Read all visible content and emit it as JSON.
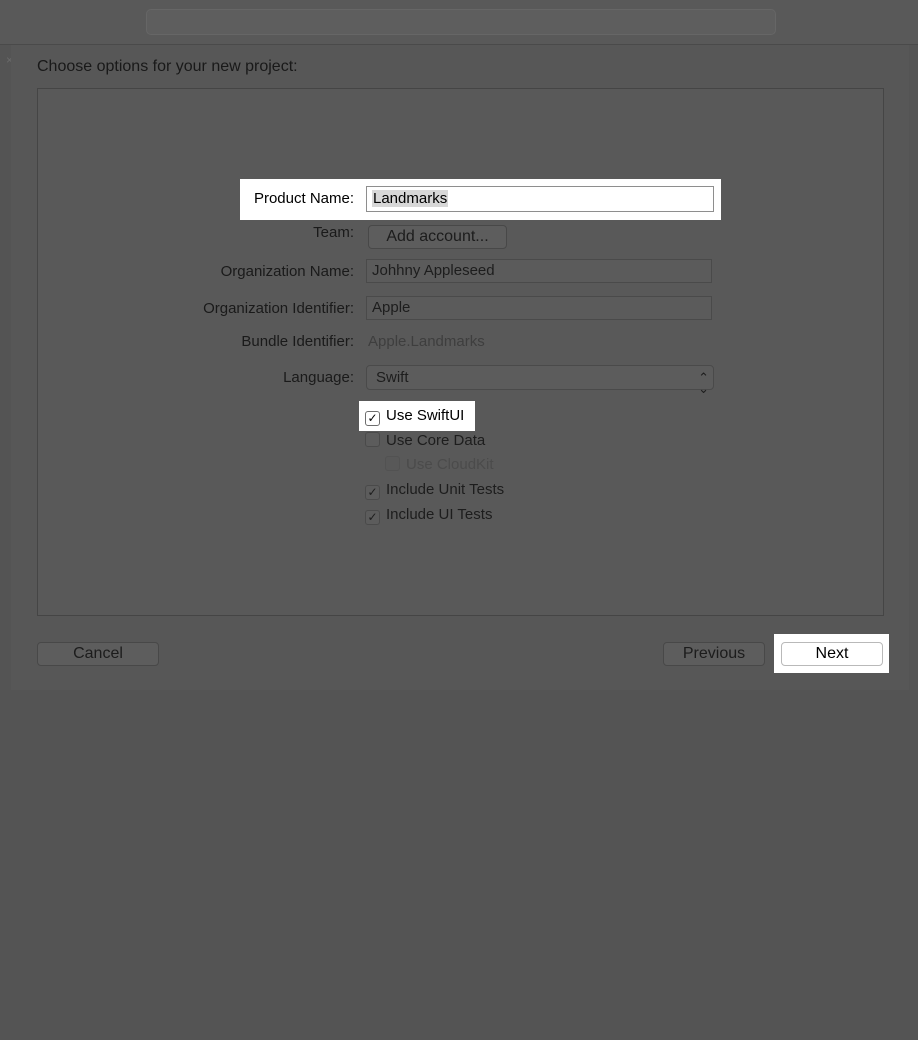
{
  "heading": "Choose options for your new project:",
  "form": {
    "product_name": {
      "label": "Product Name:",
      "value": "Landmarks"
    },
    "team": {
      "label": "Team:",
      "button_label": "Add account..."
    },
    "org_name": {
      "label": "Organization Name:",
      "value": "Johhny Appleseed"
    },
    "org_identifier": {
      "label": "Organization Identifier:",
      "value": "Apple"
    },
    "bundle_identifier": {
      "label": "Bundle Identifier:",
      "value": "Apple.Landmarks"
    },
    "language": {
      "label": "Language:",
      "selected": "Swift",
      "chevron": "⌃⌄"
    }
  },
  "options": [
    {
      "label": "Use SwiftUI",
      "checked": true,
      "mark": "✓"
    },
    {
      "label": "Use Core Data",
      "checked": false,
      "mark": ""
    },
    {
      "label": "Use CloudKit",
      "checked": false,
      "enabled": false,
      "mark": ""
    },
    {
      "label": "Include Unit Tests",
      "checked": true,
      "mark": "✓"
    },
    {
      "label": "Include UI Tests",
      "checked": true,
      "mark": "✓"
    }
  ],
  "buttons": {
    "cancel": "Cancel",
    "previous": "Previous",
    "next": "Next"
  },
  "colors": {
    "overlay": "#545454",
    "highlight": "#ffffff"
  }
}
